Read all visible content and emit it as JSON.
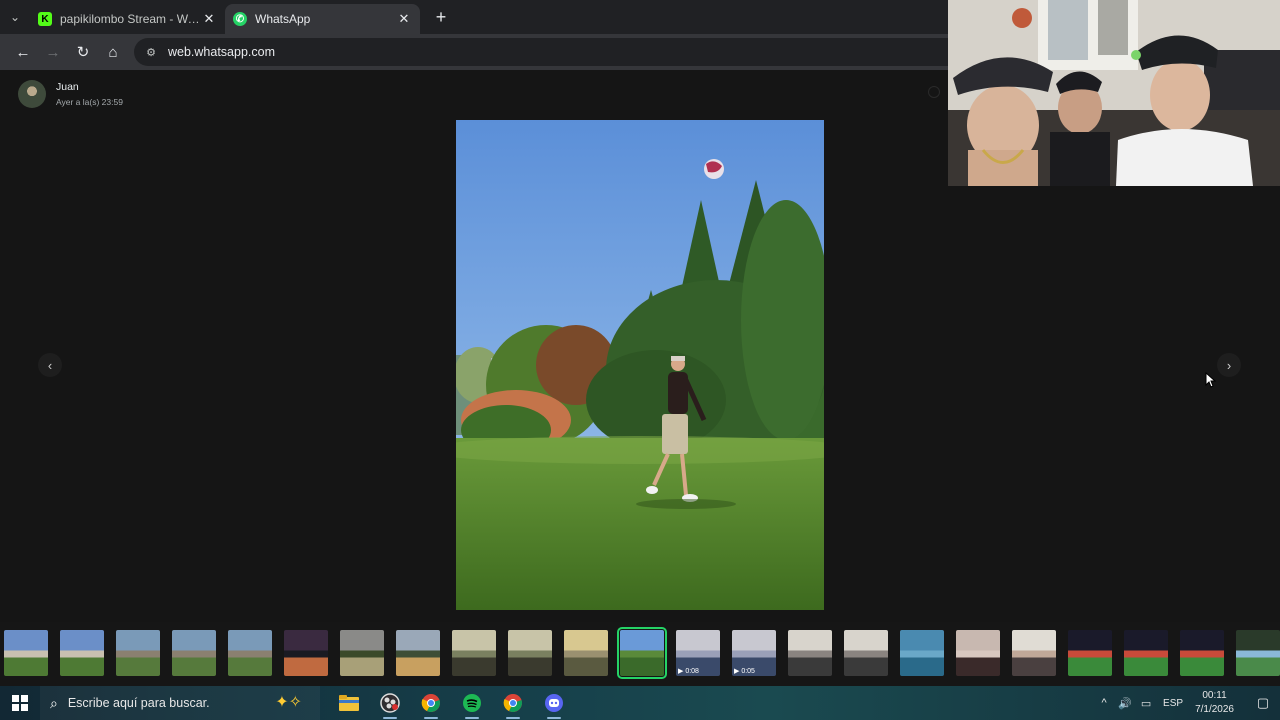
{
  "browser": {
    "tabs": [
      {
        "title": "papikilombo Stream - Watch Li",
        "favicon": "kick-icon",
        "active": false
      },
      {
        "title": "WhatsApp",
        "favicon": "whatsapp-icon",
        "active": true
      }
    ],
    "url": "web.whatsapp.com"
  },
  "viewer": {
    "contact_name": "Juan",
    "timestamp": "Ayer a la(s) 23:59"
  },
  "thumbnails": [
    {
      "kind": "photo",
      "duration": ""
    },
    {
      "kind": "photo",
      "duration": ""
    },
    {
      "kind": "photo",
      "duration": ""
    },
    {
      "kind": "photo",
      "duration": ""
    },
    {
      "kind": "photo",
      "duration": ""
    },
    {
      "kind": "photo",
      "duration": ""
    },
    {
      "kind": "photo",
      "duration": ""
    },
    {
      "kind": "photo",
      "duration": ""
    },
    {
      "kind": "photo",
      "duration": ""
    },
    {
      "kind": "photo",
      "duration": ""
    },
    {
      "kind": "photo",
      "duration": ""
    },
    {
      "kind": "photo",
      "duration": "",
      "selected": true
    },
    {
      "kind": "video",
      "duration": "0:08"
    },
    {
      "kind": "video",
      "duration": "0:05"
    },
    {
      "kind": "photo",
      "duration": ""
    },
    {
      "kind": "photo",
      "duration": ""
    },
    {
      "kind": "photo",
      "duration": ""
    },
    {
      "kind": "photo",
      "duration": ""
    },
    {
      "kind": "photo",
      "duration": ""
    },
    {
      "kind": "photo",
      "duration": ""
    },
    {
      "kind": "photo",
      "duration": ""
    },
    {
      "kind": "photo",
      "duration": ""
    },
    {
      "kind": "photo",
      "duration": ""
    }
  ],
  "taskbar": {
    "search_placeholder": "Escribe aquí para buscar.",
    "apps": [
      "file-explorer-icon",
      "obs-icon",
      "chrome-icon",
      "spotify-icon",
      "chrome-icon",
      "discord-icon"
    ],
    "language": "ESP",
    "time": "00:11",
    "date": "7/1/2026"
  },
  "colors": {
    "accent": "#25d366",
    "viewer_bg": "#151515",
    "tab_active": "#35363a"
  }
}
